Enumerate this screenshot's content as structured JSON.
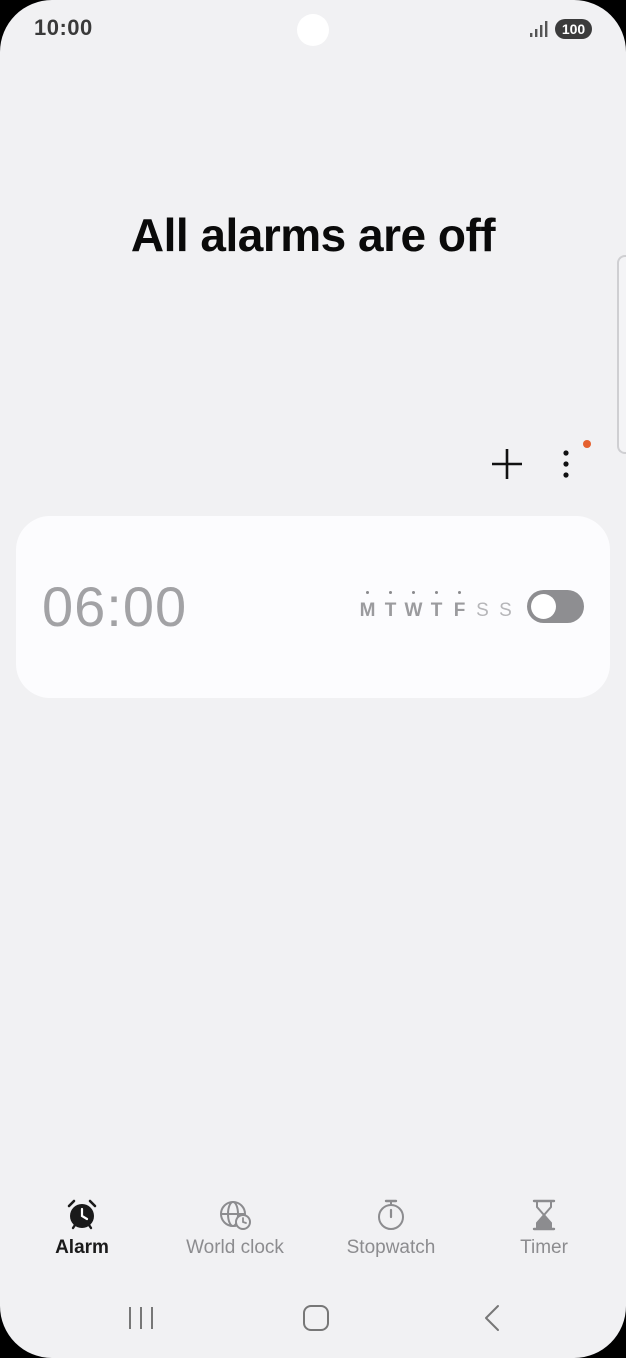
{
  "status_bar": {
    "time": "10:00",
    "battery": "100",
    "signal_icon": "signal-bars-icon"
  },
  "main": {
    "headline": "All alarms are off"
  },
  "toolbar": {
    "add_icon": "plus-icon",
    "more_icon": "more-vertical-icon",
    "badge_color": "#e5602e"
  },
  "alarms": [
    {
      "time": "06:00",
      "enabled": false,
      "days": [
        {
          "letter": "M",
          "active": true
        },
        {
          "letter": "T",
          "active": true
        },
        {
          "letter": "W",
          "active": true
        },
        {
          "letter": "T",
          "active": true
        },
        {
          "letter": "F",
          "active": true
        },
        {
          "letter": "S",
          "active": false
        },
        {
          "letter": "S",
          "active": false
        }
      ]
    }
  ],
  "tabs": [
    {
      "label": "Alarm",
      "icon": "alarm-clock-icon",
      "active": true
    },
    {
      "label": "World clock",
      "icon": "globe-clock-icon",
      "active": false
    },
    {
      "label": "Stopwatch",
      "icon": "stopwatch-icon",
      "active": false
    },
    {
      "label": "Timer",
      "icon": "hourglass-icon",
      "active": false
    }
  ],
  "nav_bar": {
    "recents_icon": "recent-apps-icon",
    "home_icon": "home-icon",
    "back_icon": "back-icon"
  }
}
